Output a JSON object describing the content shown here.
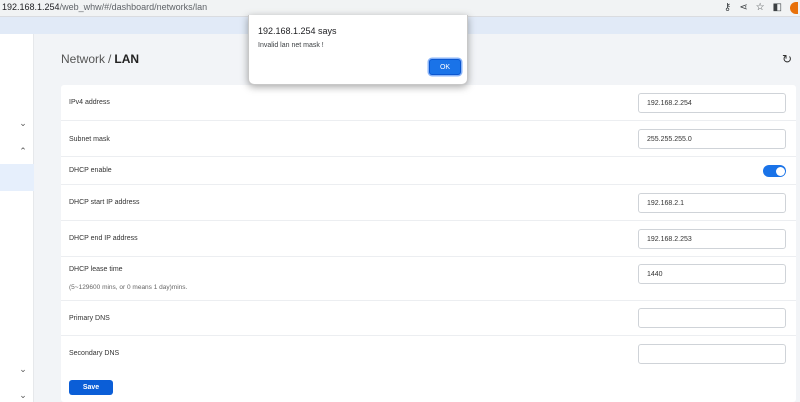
{
  "browser": {
    "url_host": "192.168.1.254",
    "url_path": "/web_whw/#/dashboard/networks/lan",
    "icons": [
      "key-icon",
      "share-icon",
      "star-icon",
      "sidepanel-icon"
    ]
  },
  "header": {
    "section": "Network",
    "separator": "/",
    "current": "LAN"
  },
  "form": {
    "ipv4_label": "IPv4 address",
    "ipv4_value": "192.168.2.254",
    "subnet_label": "Subnet mask",
    "subnet_value": "255.255.255.0",
    "dhcp_enable_label": "DHCP enable",
    "dhcp_enabled": true,
    "dhcp_start_label": "DHCP start IP address",
    "dhcp_start_value": "192.168.2.1",
    "dhcp_end_label": "DHCP end IP address",
    "dhcp_end_value": "192.168.2.253",
    "lease_label": "DHCP lease time",
    "lease_hint": "(5~129600 mins, or 0 means 1 day)mins.",
    "lease_value": "1440",
    "primary_dns_label": "Primary DNS",
    "primary_dns_value": "",
    "secondary_dns_label": "Secondary DNS",
    "secondary_dns_value": "",
    "save_label": "Save"
  },
  "dialog": {
    "title": "192.168.1.254 says",
    "message": "Invalid lan net mask !",
    "ok_label": "OK"
  },
  "colors": {
    "accent": "#1a73e8",
    "save_button": "#0b5ed7"
  }
}
